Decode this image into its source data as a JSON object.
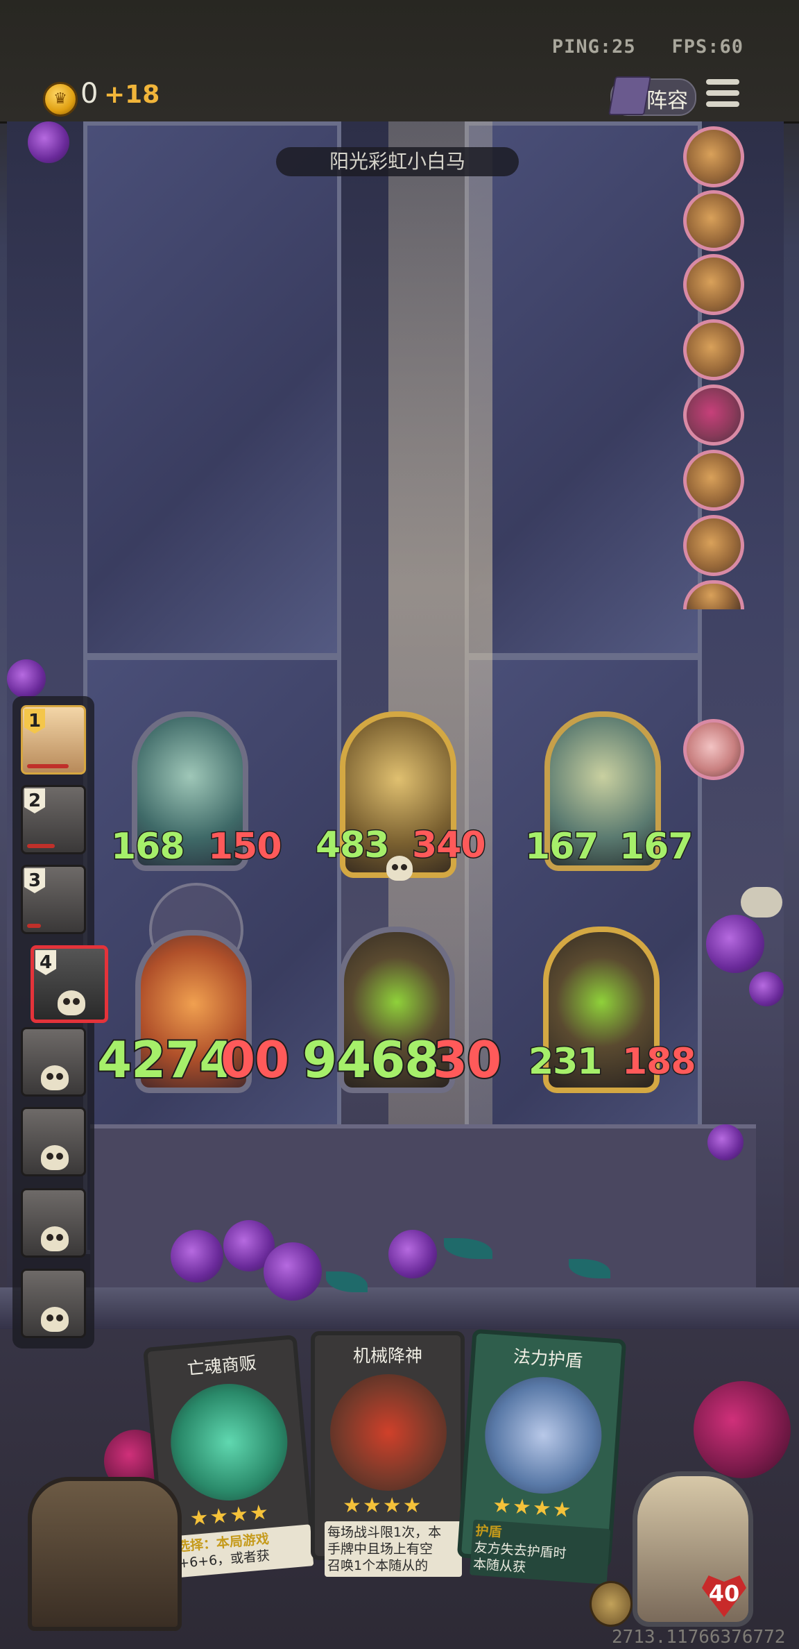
{
  "status": {
    "ping": "PING:25",
    "fps": "FPS:60"
  },
  "resources": {
    "gold": "0",
    "gold_bonus": "+18"
  },
  "buttons": {
    "lineup": "阵容"
  },
  "player_name": "阳光彩虹小白马",
  "players": [
    {
      "rank": "1",
      "state": "alive"
    },
    {
      "rank": "2",
      "state": "alive"
    },
    {
      "rank": "3",
      "state": "alive"
    },
    {
      "rank": "4",
      "state": "dead-active"
    },
    {
      "rank": "",
      "state": "dead"
    },
    {
      "rank": "",
      "state": "dead"
    },
    {
      "rank": "",
      "state": "dead"
    },
    {
      "rank": "",
      "state": "dead"
    }
  ],
  "board": {
    "top_row": [
      {
        "attack": "168",
        "health": "150"
      },
      {
        "attack": "483",
        "health": "340"
      },
      {
        "attack": "167",
        "health": "167"
      }
    ],
    "bottom_row": [
      {
        "attack": "4274",
        "health": "00"
      },
      {
        "attack": "9468",
        "health": "30"
      },
      {
        "attack": "231",
        "health": "188"
      }
    ]
  },
  "hand": [
    {
      "title": "亡魂商贩",
      "stars": "★★★★",
      "desc_a": "选择：本局游戏",
      "desc_b": "+6+6，或者获"
    },
    {
      "title": "机械降神",
      "stars": "★★★★",
      "desc_a": "每场战斗限1次，本",
      "desc_b": "手牌中且场上有空",
      "desc_c": "召唤1个本随从的"
    },
    {
      "title": "法力护盾",
      "stars": "★★★★",
      "desc_a": "护盾",
      "desc_b": "友方失去护盾时",
      "desc_c": "本随从获"
    }
  ],
  "hero": {
    "health": "40"
  },
  "footer": {
    "player_id": "2713.11766376772"
  },
  "colors": {
    "attack": "#a6ef6a",
    "health": "#ff5a5a",
    "gold_bonus": "#f1b53a",
    "active_player": "#e4333a"
  },
  "icons": [
    "coin-icon",
    "book-icon",
    "menu-icon",
    "skull-icon",
    "chat-icon",
    "upgrade-icon"
  ]
}
